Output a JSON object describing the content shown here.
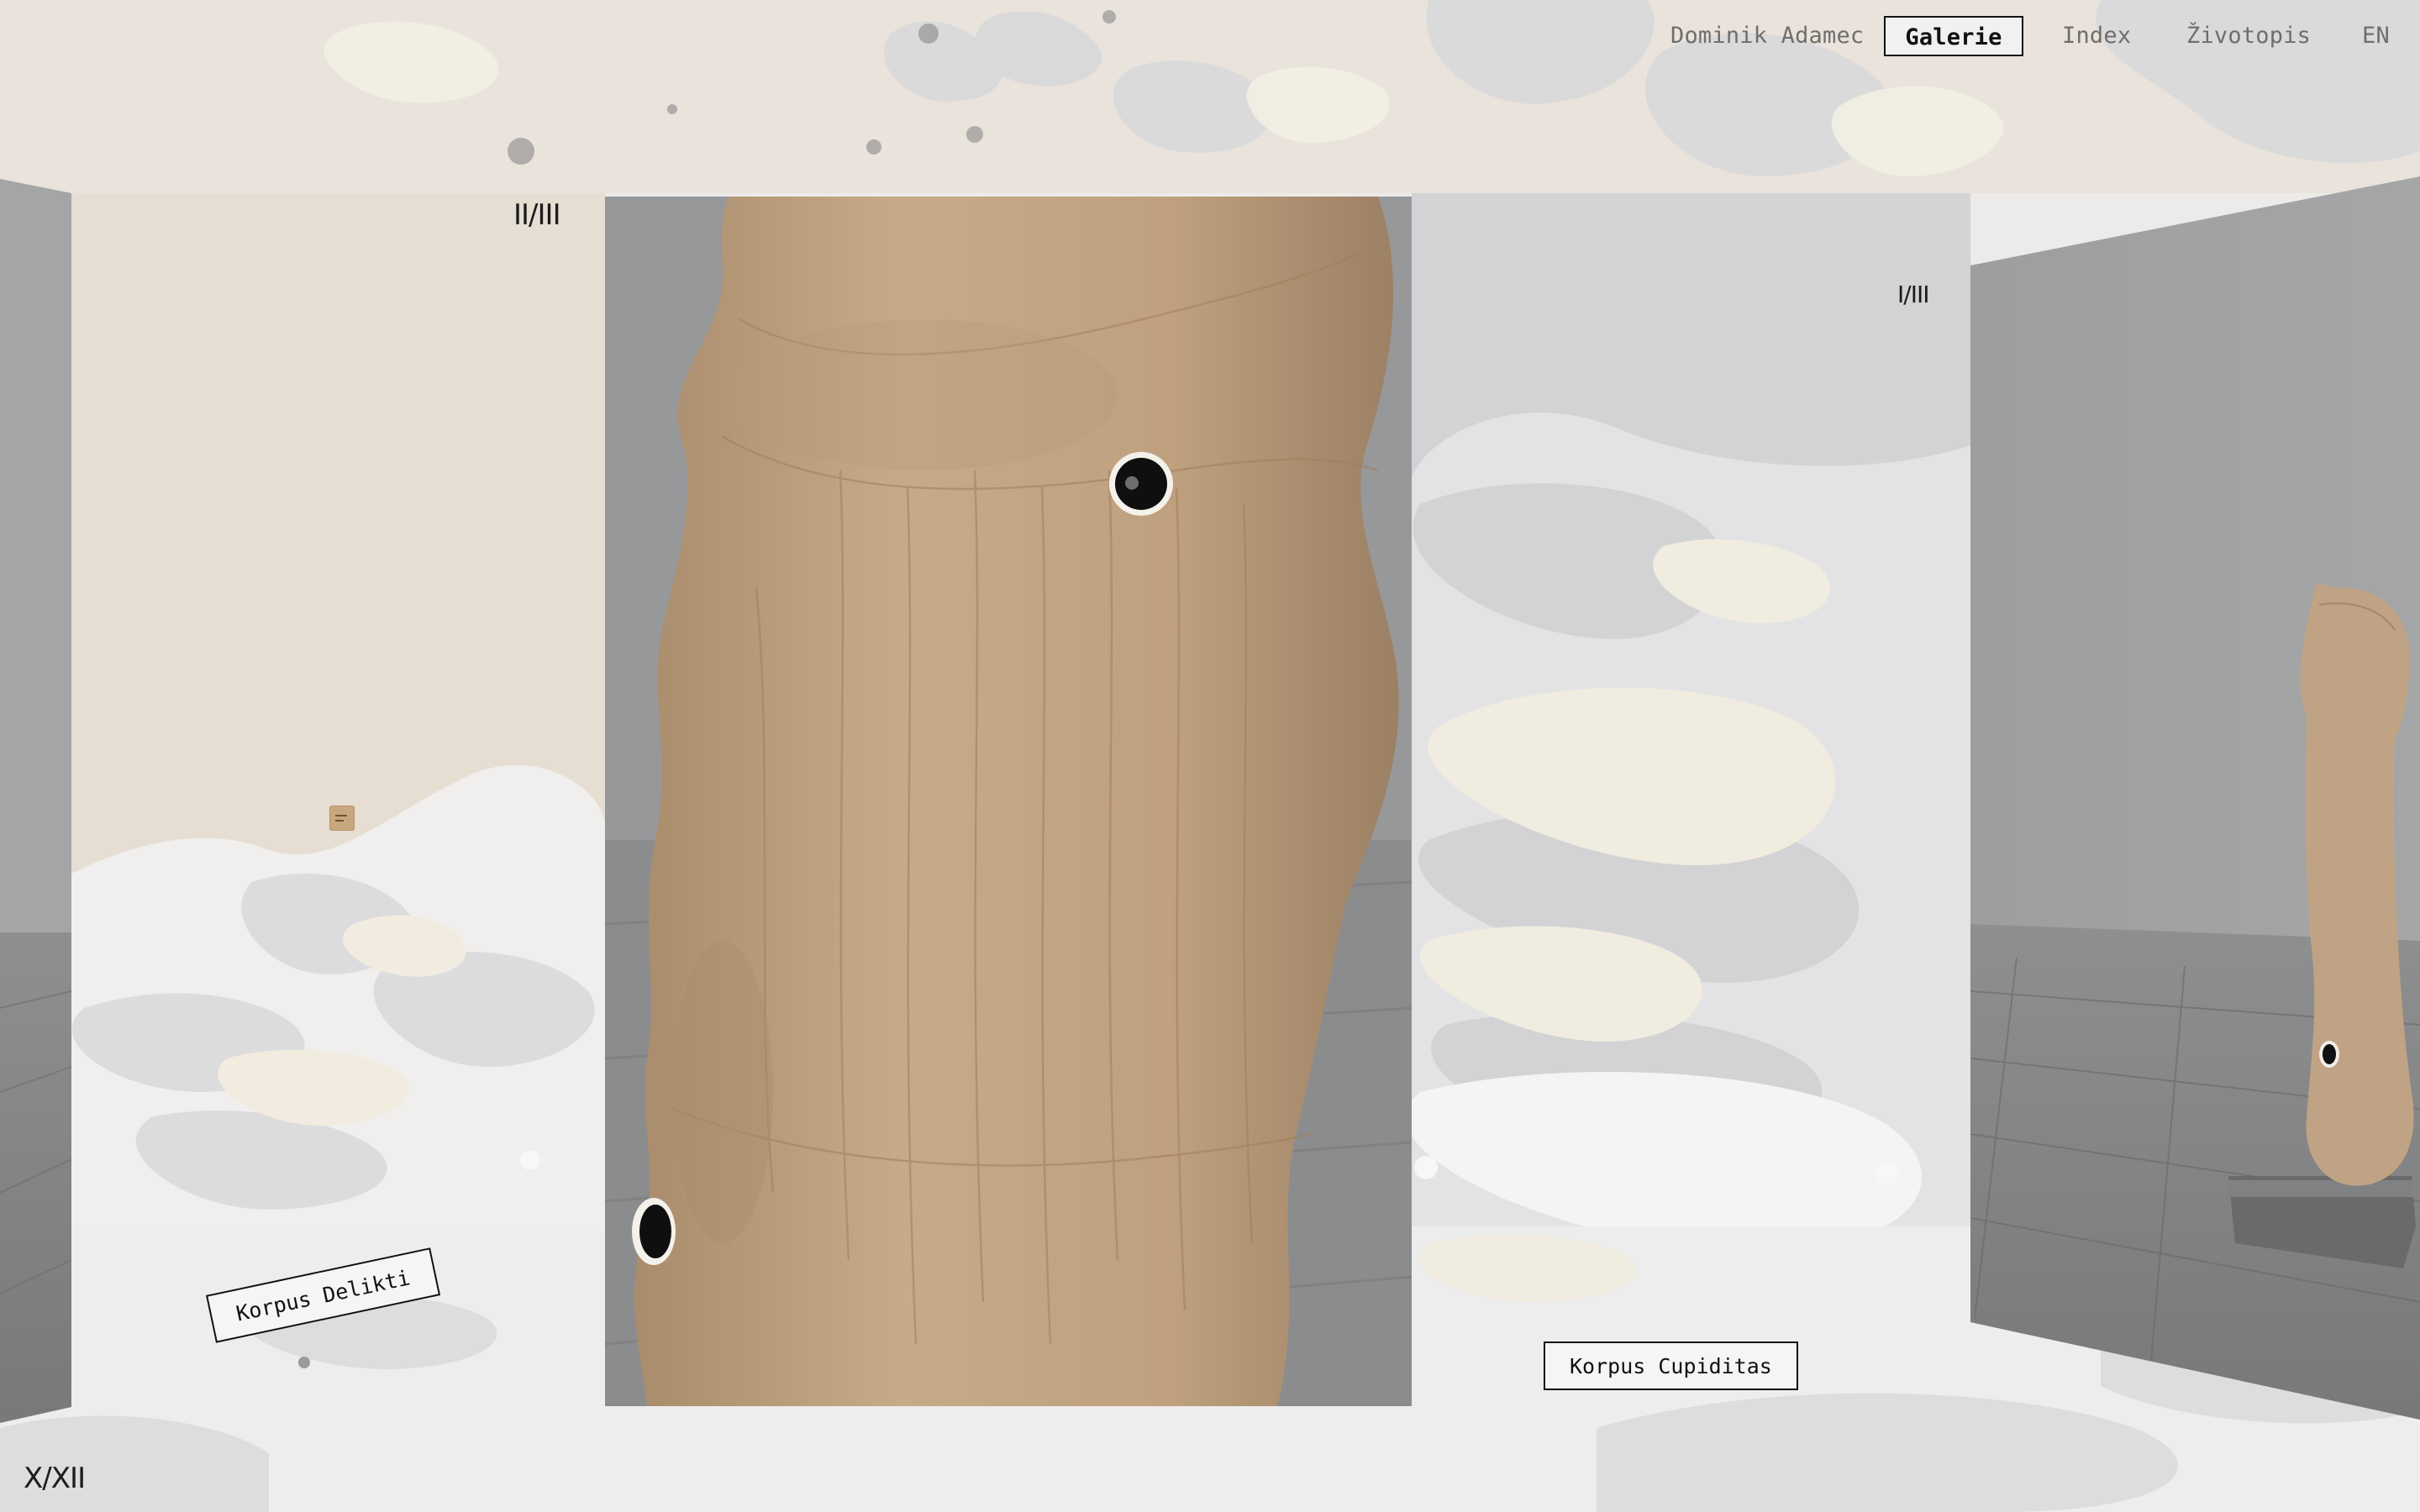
{
  "nav": {
    "home": "Dominik Adamec",
    "gallery": "Galerie",
    "index": "Index",
    "bio": "Životopis",
    "lang": "EN"
  },
  "counters": {
    "left": "II/III",
    "right": "I/III",
    "total": "X/XII"
  },
  "works": {
    "left": "Korpus Delikti",
    "right": "Korpus Cupiditas"
  },
  "colors": {
    "accent": "#111111",
    "sculpture": "#c4a583",
    "wall": "#9a9a9b",
    "floor": "#88898a",
    "beige_panel": "#e6ddd3"
  }
}
